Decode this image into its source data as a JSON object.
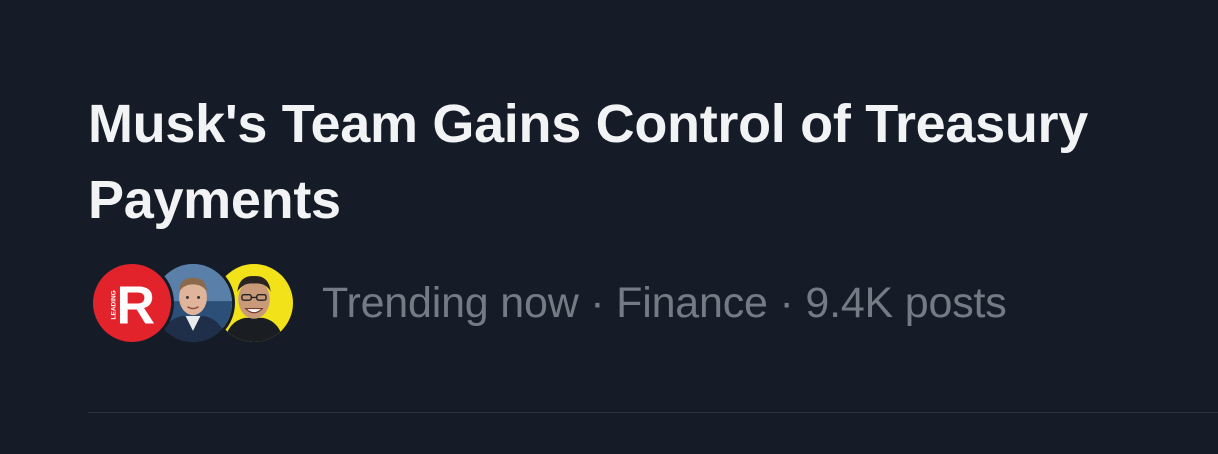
{
  "trend": {
    "headline": "Musk's Team Gains Control of Treasury Payments",
    "status": "Trending now",
    "separator": "·",
    "category": "Finance",
    "posts": "9.4K posts",
    "avatars": [
      {
        "name": "leading-report-logo-avatar",
        "logo_letter": "R",
        "logo_text": "LEADING",
        "background": "#e3232c"
      },
      {
        "name": "man-in-suit-avatar",
        "background": "#3a5f8a"
      },
      {
        "name": "laughing-man-avatar",
        "background": "#f2e21a"
      }
    ]
  },
  "colors": {
    "background": "#161c27",
    "headline_text": "#f1f3f5",
    "meta_text": "#737b85",
    "divider": "#2b323d"
  }
}
